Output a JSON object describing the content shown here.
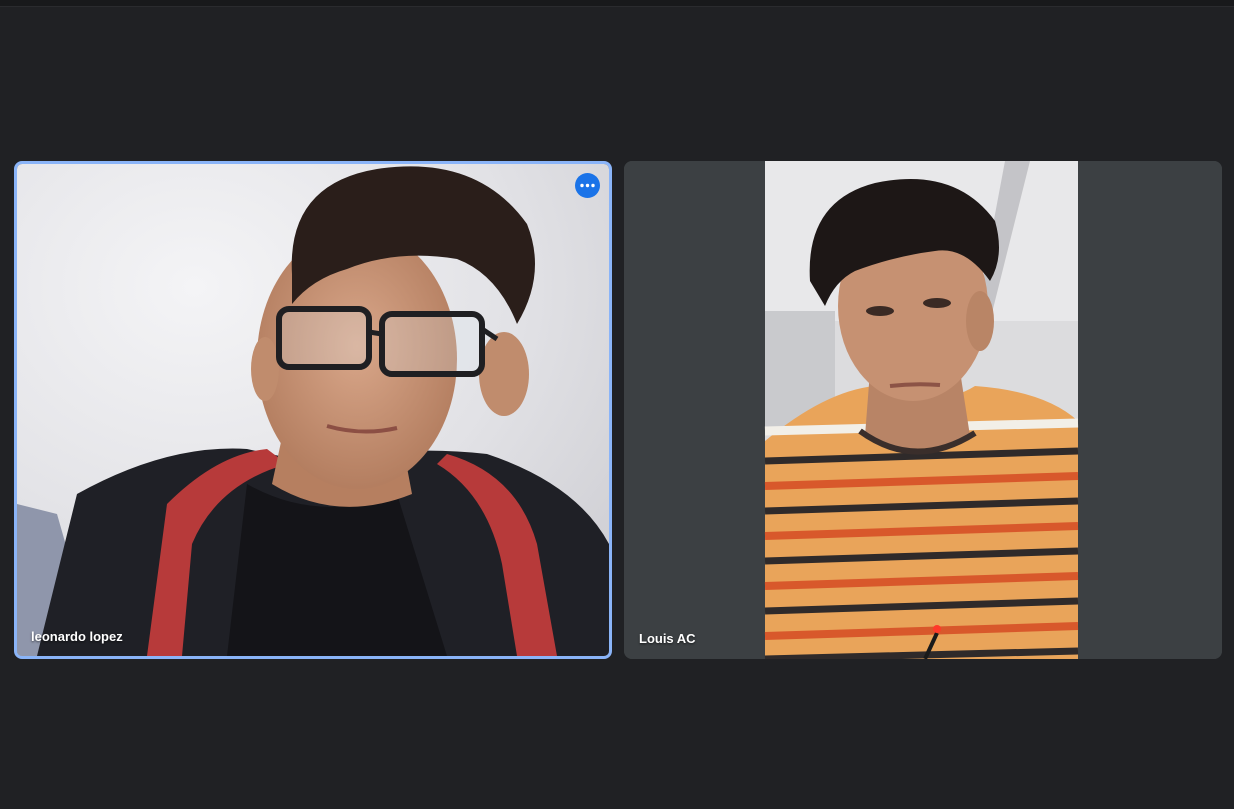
{
  "participants": [
    {
      "name": "leonardo lopez",
      "active_speaker": true,
      "more_options_icon": "more-horizontal-icon"
    },
    {
      "name": "Louis AC",
      "active_speaker": false
    }
  ],
  "colors": {
    "background": "#202124",
    "tile_background": "#3c4043",
    "active_border": "#8ab4f8",
    "more_button": "#1a73e8"
  }
}
